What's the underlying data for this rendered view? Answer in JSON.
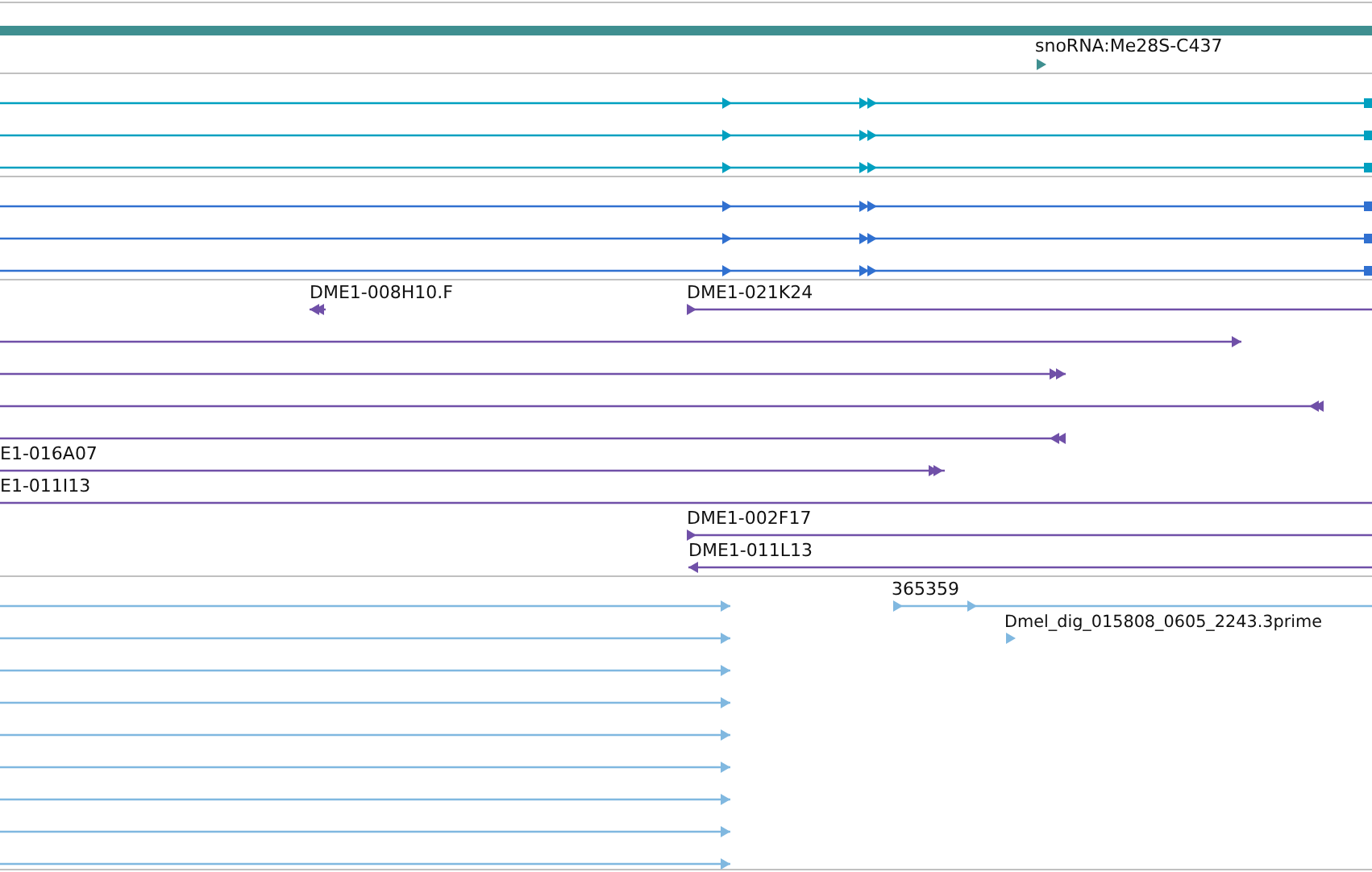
{
  "tracks": [
    {
      "kind": "band",
      "color": "#3f8f90"
    },
    {
      "kind": "gene",
      "color": "#3f8f90",
      "rows": [
        {
          "features": [
            {
              "label": "snoRNA:Me28S-C437",
              "reverse": false
            }
          ]
        }
      ]
    },
    {
      "kind": "transcript",
      "color": "#00a0c0",
      "rows": [
        {
          "features": [
            {
              "reverse": false
            }
          ]
        },
        {
          "features": [
            {
              "reverse": false
            }
          ]
        },
        {
          "features": [
            {
              "reverse": false
            }
          ]
        }
      ]
    },
    {
      "kind": "transcript",
      "color": "#3070d0",
      "rows": [
        {
          "features": [
            {
              "reverse": false
            }
          ]
        },
        {
          "features": [
            {
              "reverse": false
            }
          ]
        },
        {
          "features": [
            {
              "reverse": false
            }
          ]
        }
      ]
    },
    {
      "kind": "clone",
      "color": "#7050a8",
      "rows": [
        {
          "features": [
            {
              "label": "DME1-008H10.F",
              "reverse": true
            },
            {
              "label": "DME1-021K24",
              "reverse": false
            }
          ]
        },
        {
          "features": [
            {
              "reverse": false
            }
          ]
        },
        {
          "features": [
            {
              "reverse": false
            }
          ]
        },
        {
          "features": [
            {
              "reverse": true
            }
          ]
        },
        {
          "features": [
            {
              "reverse": true
            }
          ]
        },
        {
          "features": [
            {
              "label": "E1-016A07",
              "reverse": false
            }
          ]
        },
        {
          "features": [
            {
              "label": "E1-011I13"
            }
          ]
        },
        {
          "features": [
            {
              "label": "DME1-002F17",
              "reverse": false
            }
          ]
        },
        {
          "features": [
            {
              "label": "DME1-011L13",
              "reverse": true
            }
          ]
        }
      ]
    },
    {
      "kind": "est",
      "color": "#80b8e0",
      "rows": [
        {
          "features": [
            {
              "reverse": false
            },
            {
              "label": "365359",
              "reverse": false
            }
          ]
        },
        {
          "features": [
            {
              "reverse": false
            },
            {
              "label": "Dmel_dig_015808_0605_2243.3prime",
              "reverse": false
            }
          ]
        },
        {
          "features": [
            {
              "reverse": false
            }
          ]
        },
        {
          "features": [
            {
              "reverse": false
            }
          ]
        },
        {
          "features": [
            {
              "reverse": false
            }
          ]
        },
        {
          "features": [
            {
              "reverse": false
            }
          ]
        },
        {
          "features": [
            {
              "reverse": false
            }
          ]
        },
        {
          "features": [
            {
              "reverse": false
            }
          ]
        },
        {
          "features": [
            {
              "reverse": false
            }
          ]
        }
      ]
    }
  ]
}
